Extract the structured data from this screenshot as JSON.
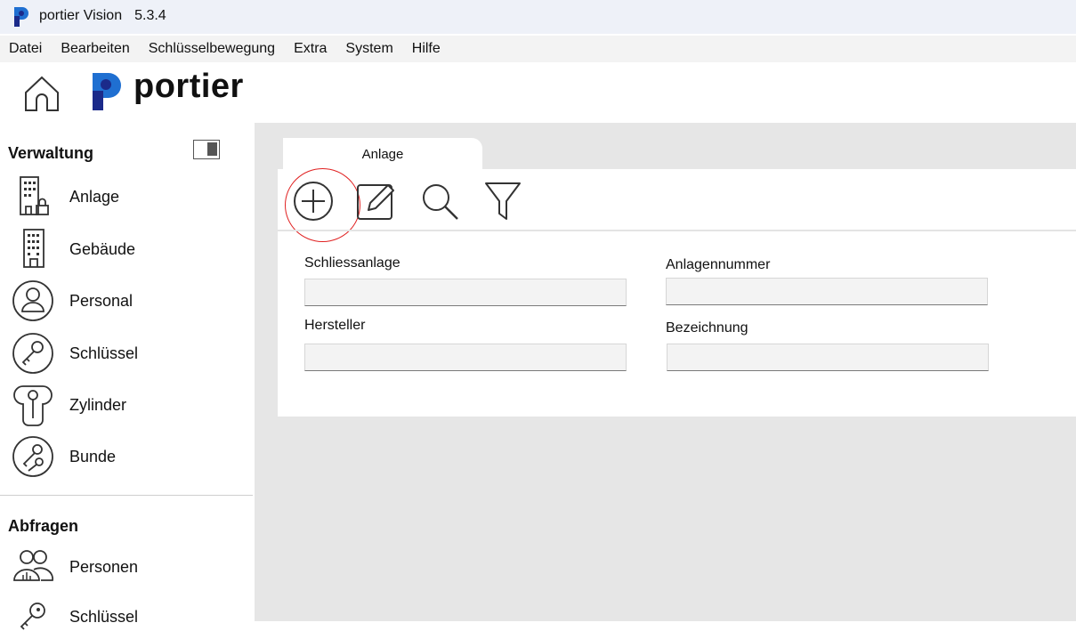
{
  "window": {
    "title": "portier Vision",
    "version": "5.3.4"
  },
  "menu": [
    "Datei",
    "Bearbeiten",
    "Schlüsselbewegung",
    "Extra",
    "System",
    "Hilfe"
  ],
  "brand": {
    "name": "portier"
  },
  "colors": {
    "brand_blue": "#1f6fd1",
    "brand_navy": "#1b2a8a",
    "highlight_red": "#e02020"
  },
  "sidebar": {
    "verwaltung_title": "Verwaltung",
    "verwaltung_items": [
      {
        "label": "Anlage",
        "icon": "building-lock-icon"
      },
      {
        "label": "Gebäude",
        "icon": "building-icon"
      },
      {
        "label": "Personal",
        "icon": "person-icon"
      },
      {
        "label": "Schlüssel",
        "icon": "key-icon"
      },
      {
        "label": "Zylinder",
        "icon": "cylinder-icon"
      },
      {
        "label": "Bunde",
        "icon": "key-bunch-icon"
      }
    ],
    "abfragen_title": "Abfragen",
    "abfragen_items": [
      {
        "label": "Personen",
        "icon": "people-icon"
      },
      {
        "label": "Schlüssel",
        "icon": "key-icon"
      }
    ]
  },
  "main": {
    "tab_label": "Anlage",
    "toolbar": [
      "add-icon",
      "edit-icon",
      "search-icon",
      "filter-icon"
    ],
    "fields": {
      "schliessanlage": {
        "label": "Schliessanlage",
        "value": ""
      },
      "anlagennummer": {
        "label": "Anlagennummer",
        "value": ""
      },
      "hersteller": {
        "label": "Hersteller",
        "value": ""
      },
      "bezeichnung": {
        "label": "Bezeichnung",
        "value": ""
      }
    }
  }
}
